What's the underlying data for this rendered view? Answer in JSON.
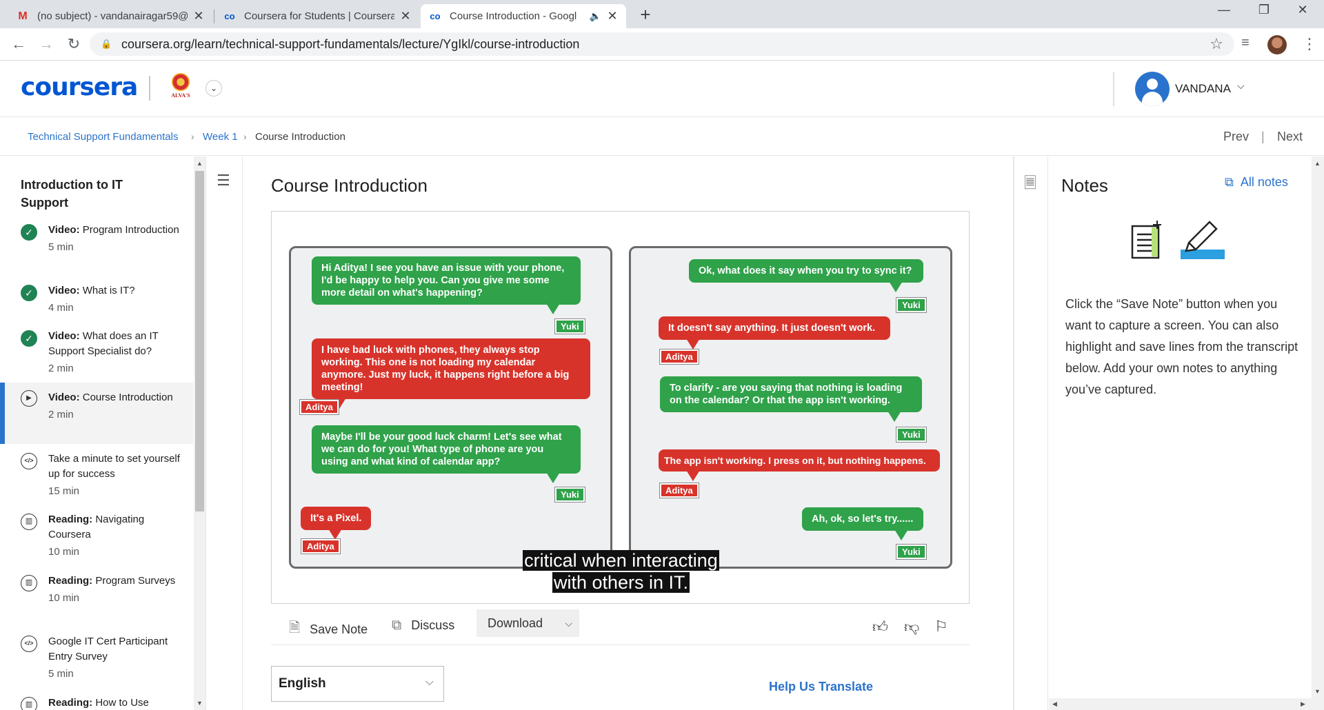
{
  "browser": {
    "tabs": [
      {
        "title": "(no subject) - vandanairagar59@",
        "favicon": "M"
      },
      {
        "title": "Coursera for Students | Coursera",
        "favicon": "co"
      },
      {
        "title": "Course Introduction - Googl",
        "favicon": "co"
      }
    ],
    "url": "coursera.org/learn/technical-support-fundamentals/lecture/YgIkl/course-introduction"
  },
  "header": {
    "logo": "coursera",
    "institution": "ALVA'S",
    "user": "VANDANA"
  },
  "breadcrumb": {
    "course": "Technical Support Fundamentals",
    "week": "Week 1",
    "current": "Course Introduction",
    "prev": "Prev",
    "next": "Next"
  },
  "sidebar": {
    "title": "Introduction to IT Support",
    "items": [
      {
        "kind": "Video:",
        "title": "Program Introduction",
        "duration": "5 min",
        "status": "done",
        "icon": "check-icon"
      },
      {
        "kind": "Video:",
        "title": "What is IT?",
        "duration": "4 min",
        "status": "done",
        "icon": "check-icon"
      },
      {
        "kind": "Video:",
        "title": "What does an IT Support Specialist do?",
        "duration": "2 min",
        "status": "done",
        "icon": "check-icon"
      },
      {
        "kind": "Video:",
        "title": "Course Introduction",
        "duration": "2 min",
        "status": "current",
        "icon": "play-icon"
      },
      {
        "kind": "",
        "title": "Take a minute to set yourself up for success",
        "duration": "15 min",
        "status": "todo",
        "icon": "code-icon"
      },
      {
        "kind": "Reading:",
        "title": "Navigating Coursera",
        "duration": "10 min",
        "status": "todo",
        "icon": "book-icon"
      },
      {
        "kind": "Reading:",
        "title": "Program Surveys",
        "duration": "10 min",
        "status": "todo",
        "icon": "book-icon"
      },
      {
        "kind": "",
        "title": "Google IT Cert Participant Entry Survey",
        "duration": "5 min",
        "status": "todo",
        "icon": "code-icon"
      },
      {
        "kind": "Reading:",
        "title": "How to Use",
        "duration": "",
        "status": "todo",
        "icon": "book-icon"
      }
    ]
  },
  "main": {
    "title": "Course Introduction",
    "video": {
      "left_panel": [
        {
          "speaker": "Yuki",
          "text": "Hi Aditya! I see you have an issue with your phone, I'd be happy to help you. Can you give me some more detail on what's happening?"
        },
        {
          "speaker": "Aditya",
          "text": "I have bad luck with phones, they always stop working. This one is not loading my calendar anymore. Just my luck, it happens right before a big meeting!"
        },
        {
          "speaker": "Yuki",
          "text": "Maybe I'll be your good luck charm! Let's see what we can do for you! What type of phone are you using and what kind of calendar app?"
        },
        {
          "speaker": "Aditya",
          "text": "It's a Pixel."
        }
      ],
      "right_panel": [
        {
          "speaker": "Yuki",
          "text": "Ok, what does it say when you try to sync it?"
        },
        {
          "speaker": "Aditya",
          "text": "It doesn't say anything. It just doesn't work."
        },
        {
          "speaker": "Yuki",
          "text": "To clarify - are you saying that nothing is loading on the calendar? Or that the app isn't working."
        },
        {
          "speaker": "Aditya",
          "text": "The app isn't working. I press on it, but nothing happens."
        },
        {
          "speaker": "Yuki",
          "text": "Ah, ok, so let's try......"
        }
      ],
      "caption_line1": "critical when interacting",
      "caption_line2": "with others in IT."
    },
    "actions": {
      "save_note": "Save Note",
      "discuss": "Discuss",
      "download": "Download"
    },
    "language": "English",
    "help_translate": "Help Us Translate"
  },
  "notes": {
    "title": "Notes",
    "all_notes": "All notes",
    "description": "Click the “Save Note” button when you want to capture a screen. You can also highlight and save lines from the transcript below. Add your own notes to anything you’ve captured."
  },
  "colors": {
    "accent": "#2a73cc",
    "yuki_green": "#2fa24a",
    "aditya_red": "#d8332b",
    "check_green": "#1f8354"
  }
}
